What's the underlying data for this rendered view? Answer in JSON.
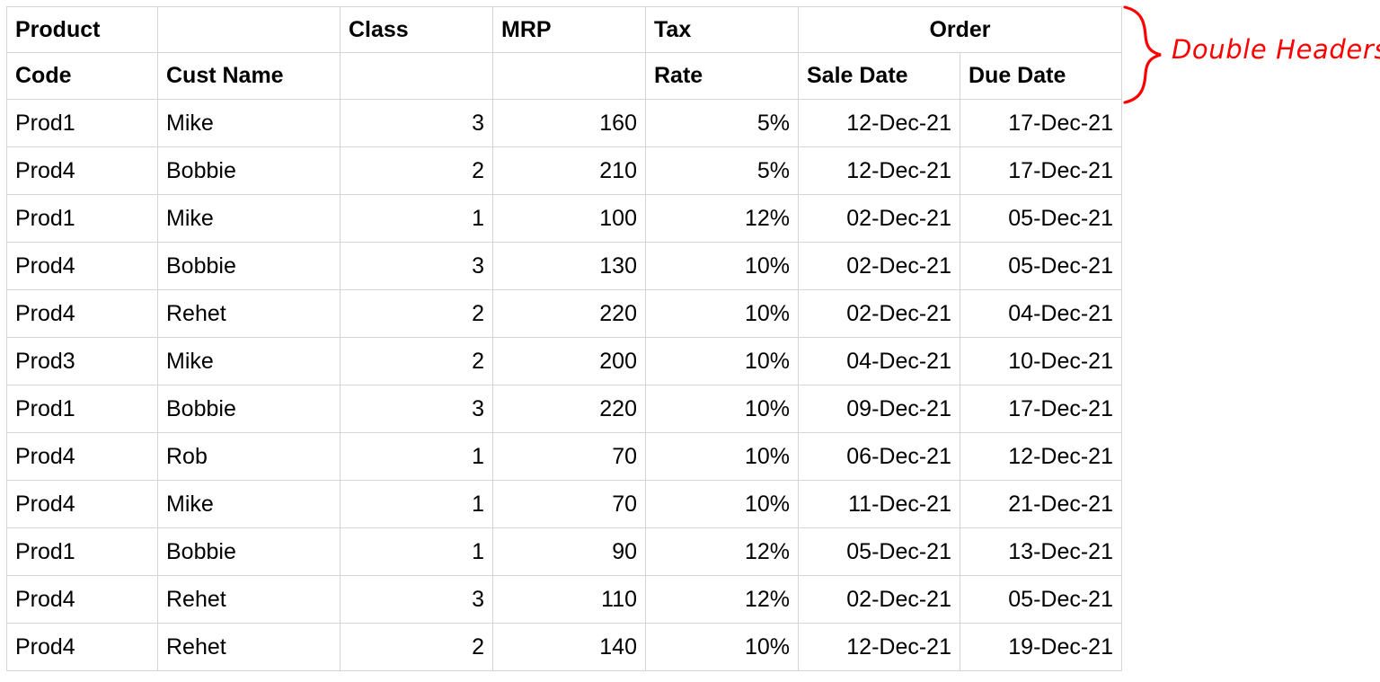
{
  "table": {
    "header_row_1": [
      {
        "label": "Product",
        "align": "left",
        "colspan": 1
      },
      {
        "label": "",
        "align": "left",
        "colspan": 1
      },
      {
        "label": "Class",
        "align": "left",
        "colspan": 1
      },
      {
        "label": "MRP",
        "align": "left",
        "colspan": 1
      },
      {
        "label": "Tax",
        "align": "left",
        "colspan": 1
      },
      {
        "label": "Order",
        "align": "center",
        "colspan": 2
      }
    ],
    "header_row_2": [
      {
        "label": "Code",
        "align": "left"
      },
      {
        "label": "Cust Name",
        "align": "left"
      },
      {
        "label": "",
        "align": "left"
      },
      {
        "label": "",
        "align": "left"
      },
      {
        "label": "Rate",
        "align": "left"
      },
      {
        "label": "Sale Date",
        "align": "left"
      },
      {
        "label": "Due Date",
        "align": "left"
      }
    ],
    "columns": [
      "Code",
      "Cust Name",
      "Class",
      "MRP",
      "Rate",
      "Sale Date",
      "Due Date"
    ],
    "rows": [
      {
        "code": "Prod1",
        "cust_name": "Mike",
        "class": "3",
        "mrp": "160",
        "rate": "5%",
        "sale_date": "12-Dec-21",
        "due_date": "17-Dec-21"
      },
      {
        "code": "Prod4",
        "cust_name": "Bobbie",
        "class": "2",
        "mrp": "210",
        "rate": "5%",
        "sale_date": "12-Dec-21",
        "due_date": "17-Dec-21"
      },
      {
        "code": "Prod1",
        "cust_name": "Mike",
        "class": "1",
        "mrp": "100",
        "rate": "12%",
        "sale_date": "02-Dec-21",
        "due_date": "05-Dec-21"
      },
      {
        "code": "Prod4",
        "cust_name": "Bobbie",
        "class": "3",
        "mrp": "130",
        "rate": "10%",
        "sale_date": "02-Dec-21",
        "due_date": "05-Dec-21"
      },
      {
        "code": "Prod4",
        "cust_name": "Rehet",
        "class": "2",
        "mrp": "220",
        "rate": "10%",
        "sale_date": "02-Dec-21",
        "due_date": "04-Dec-21"
      },
      {
        "code": "Prod3",
        "cust_name": "Mike",
        "class": "2",
        "mrp": "200",
        "rate": "10%",
        "sale_date": "04-Dec-21",
        "due_date": "10-Dec-21"
      },
      {
        "code": "Prod1",
        "cust_name": "Bobbie",
        "class": "3",
        "mrp": "220",
        "rate": "10%",
        "sale_date": "09-Dec-21",
        "due_date": "17-Dec-21"
      },
      {
        "code": "Prod4",
        "cust_name": "Rob",
        "class": "1",
        "mrp": "70",
        "rate": "10%",
        "sale_date": "06-Dec-21",
        "due_date": "12-Dec-21"
      },
      {
        "code": "Prod4",
        "cust_name": "Mike",
        "class": "1",
        "mrp": "70",
        "rate": "10%",
        "sale_date": "11-Dec-21",
        "due_date": "21-Dec-21"
      },
      {
        "code": "Prod1",
        "cust_name": "Bobbie",
        "class": "1",
        "mrp": "90",
        "rate": "12%",
        "sale_date": "05-Dec-21",
        "due_date": "13-Dec-21"
      },
      {
        "code": "Prod4",
        "cust_name": "Rehet",
        "class": "3",
        "mrp": "110",
        "rate": "12%",
        "sale_date": "02-Dec-21",
        "due_date": "05-Dec-21"
      },
      {
        "code": "Prod4",
        "cust_name": "Rehet",
        "class": "2",
        "mrp": "140",
        "rate": "10%",
        "sale_date": "12-Dec-21",
        "due_date": "19-Dec-21"
      }
    ]
  },
  "annotation": {
    "text": "Double Headers",
    "color": "#FF0000",
    "brace": "right-curly-brace"
  },
  "colors": {
    "header_text": "#4472C4",
    "gridline": "#D4D4D4",
    "body_text": "#000000",
    "background": "#FFFFFF",
    "annotation": "#FF0000"
  }
}
